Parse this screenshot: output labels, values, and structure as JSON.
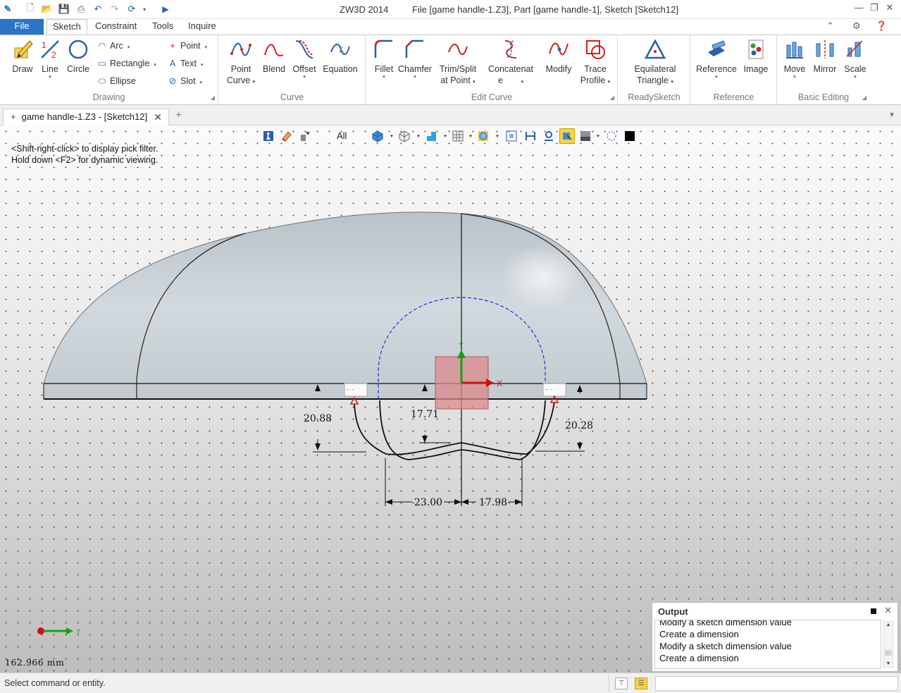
{
  "titlebar": {
    "app": "ZW3D 2014",
    "document": "File [game handle-1.Z3],  Part [game handle-1],  Sketch [Sketch12]"
  },
  "ribbon_tabs": [
    {
      "label": "File"
    },
    {
      "label": "Sketch"
    },
    {
      "label": "Constraint"
    },
    {
      "label": "Tools"
    },
    {
      "label": "Inquire"
    }
  ],
  "ribbon": {
    "drawing": {
      "label": "Drawing",
      "draw": "Draw",
      "line": "Line",
      "circle": "Circle",
      "arc": "Arc",
      "rectangle": "Rectangle",
      "ellipse": "Ellipse",
      "point": "Point",
      "text": "Text",
      "slot": "Slot"
    },
    "curve": {
      "label": "Curve",
      "point_curve_1": "Point",
      "point_curve_2": "Curve",
      "blend": "Blend",
      "offset": "Offset",
      "equation": "Equation"
    },
    "edit_curve": {
      "label": "Edit Curve",
      "fillet": "Fillet",
      "chamfer": "Chamfer",
      "trim_1": "Trim/Split",
      "trim_2": "at Point",
      "concat_1": "Concatenat",
      "concat_2": "e",
      "modify": "Modify",
      "trace_1": "Trace",
      "trace_2": "Profile"
    },
    "readysketch": {
      "label": "ReadySketch",
      "eq_1": "Equilateral",
      "eq_2": "Triangle"
    },
    "reference": {
      "label": "Reference",
      "reference": "Reference",
      "image": "Image"
    },
    "basic_editing": {
      "label": "Basic Editing",
      "move": "Move",
      "mirror": "Mirror",
      "scale": "Scale"
    }
  },
  "doc_tab": {
    "label": "game handle-1.Z3 - [Sketch12]"
  },
  "view_toolbar": {
    "filter": "All"
  },
  "hint": {
    "line1": "<Shift-right-click> to display pick filter.",
    "line2": "Hold down <F2> for dynamic viewing."
  },
  "dimensions": {
    "left_height": "20.88",
    "center_height": "17.71",
    "right_height": "20.28",
    "left_width": "23.00",
    "right_width": "17.98"
  },
  "axis_labels": {
    "x": "X",
    "y": "Y"
  },
  "viewport": {
    "readout": "162.966 mm"
  },
  "output": {
    "title": "Output",
    "lines": [
      "Modify a sketch dimension value",
      "Create a dimension",
      "Modify a sketch dimension value",
      "Create a dimension"
    ]
  },
  "status": {
    "text": "Select command or entity.",
    "input_value": ""
  },
  "colors": {
    "file_tab": "#2b74c7",
    "body_fill": "#c6ced4",
    "profile_dashed": "#1f2fd8",
    "anchor_box": "#d9898b",
    "axis_x": "#d01010",
    "axis_y": "#16a116"
  }
}
